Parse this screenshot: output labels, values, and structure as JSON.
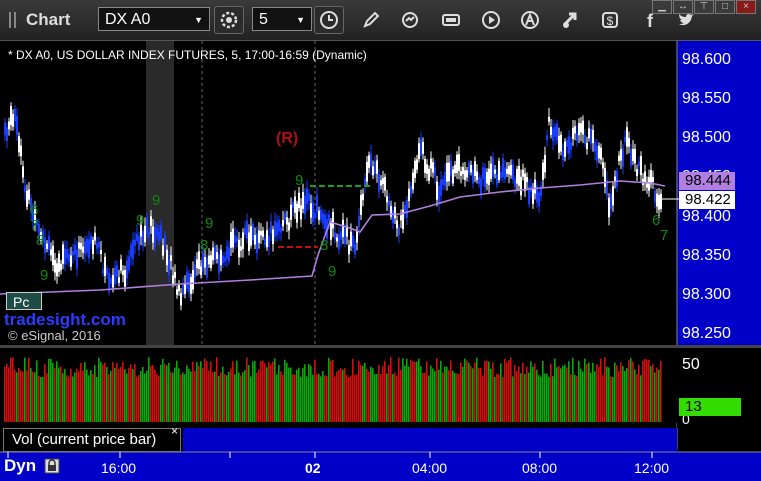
{
  "toolbar": {
    "title": "Chart",
    "symbol": "DX A0",
    "interval": "5"
  },
  "chart": {
    "legend": "* DX A0, US DOLLAR INDEX FUTURES, 5, 17:00-16:59 (Dynamic)",
    "watermark": "tradesight.com",
    "copyright": "© eSignal, 2016",
    "badge": "Pc",
    "marker_r": "(R)",
    "price_labels": [
      "98.600",
      "98.550",
      "98.500",
      "98.450",
      "98.400",
      "98.350",
      "98.300",
      "98.250"
    ],
    "current_price": "98.422",
    "ma_price": "98.444",
    "vol_labels": [
      "50",
      "0"
    ],
    "vol_current": "13",
    "vol_panel_label": "Vol (current price bar)",
    "vol_close": "×",
    "time_labels": [
      "16:00",
      "02",
      "04:00",
      "08:00",
      "12:00"
    ],
    "bottom_label": "Dyn"
  },
  "chart_data": {
    "type": "candlestick",
    "y_range": [
      98.24,
      98.62
    ],
    "price_ticks": [
      98.6,
      98.55,
      98.5,
      98.45,
      98.4,
      98.35,
      98.3,
      98.25
    ],
    "last_price": 98.422,
    "ma_value": 98.444,
    "volume_ticks": [
      50,
      0
    ],
    "last_volume": 13
  },
  "colors": {
    "up": "#ffffff",
    "down": "#1a3cff",
    "ma": "#b07fe0",
    "vol_up": "#0aa60a",
    "vol_down": "#d01010",
    "axis_bg": "#0000c8",
    "td": "#0e8a0e"
  }
}
